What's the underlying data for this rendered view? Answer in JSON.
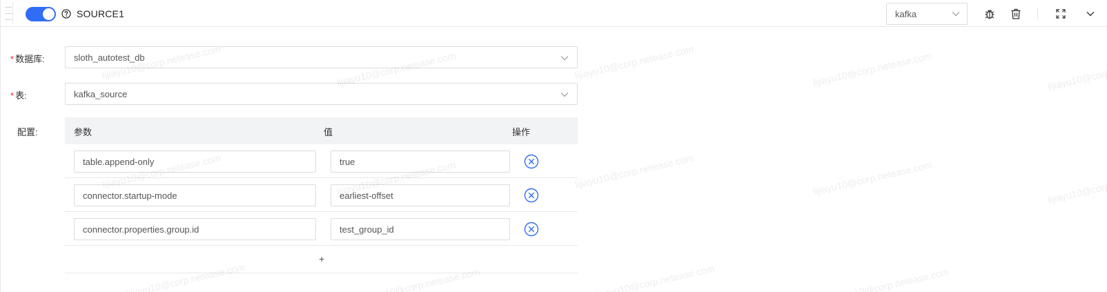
{
  "header": {
    "title": "SOURCE1",
    "enabled": true,
    "type_select": {
      "value": "kafka"
    }
  },
  "form": {
    "database": {
      "label": "数据库:",
      "value": "sloth_autotest_db"
    },
    "table": {
      "label": "表:",
      "value": "kafka_source"
    },
    "config": {
      "label": "配置:"
    }
  },
  "config_table": {
    "columns": [
      "参数",
      "值",
      "操作"
    ],
    "rows": [
      {
        "param": "table.append-only",
        "value": "true"
      },
      {
        "param": "connector.startup-mode",
        "value": "earliest-offset"
      },
      {
        "param": "connector.properties.group.id",
        "value": "test_group_id"
      }
    ],
    "add_label": "+"
  },
  "watermark": {
    "text": "lijiayu10@corp.netease.com"
  },
  "colors": {
    "accent": "#2f6df6",
    "required": "#f5222d",
    "table_header": "#f2f3f5"
  },
  "icons": {
    "help": "question-circle-icon",
    "debug": "bug-icon",
    "delete": "trash-icon",
    "expand": "fullscreen-icon",
    "collapse": "chevron-down-icon",
    "row_delete": "close-circle-icon"
  }
}
